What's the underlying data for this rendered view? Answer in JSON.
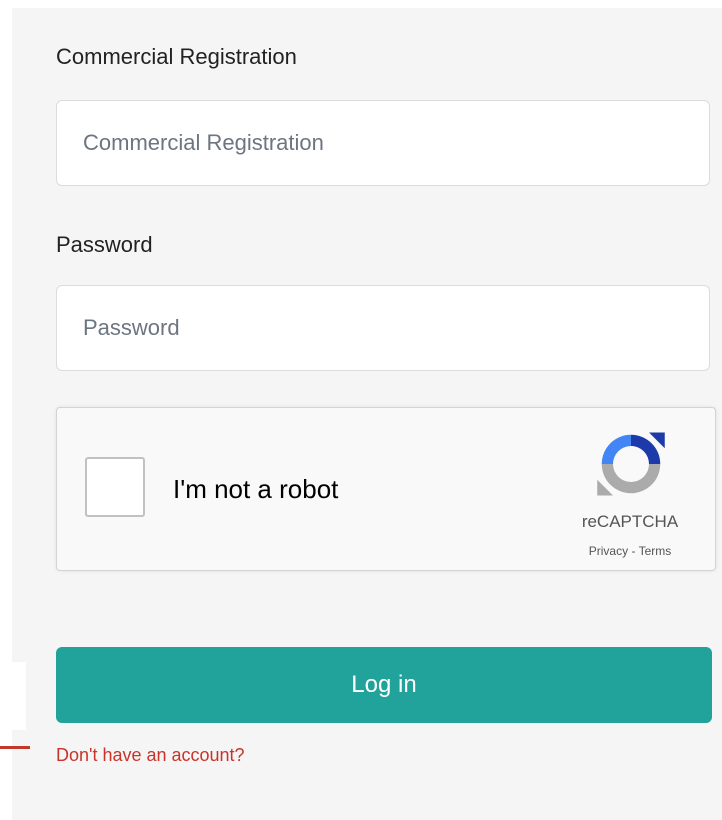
{
  "form": {
    "commercial_registration": {
      "label": "Commercial Registration",
      "placeholder": "Commercial Registration",
      "value": ""
    },
    "password": {
      "label": "Password",
      "placeholder": "Password",
      "value": ""
    },
    "recaptcha": {
      "checkbox_label": "I'm not a robot",
      "brand": "reCAPTCHA",
      "privacy_label": "Privacy",
      "separator": " - ",
      "terms_label": "Terms",
      "checked": false
    },
    "login_label": "Log in",
    "signup_link": "Don't have an account?"
  },
  "colors": {
    "accent": "#21a29a",
    "link": "#c9342a",
    "panel_background": "#f5f5f5",
    "recaptcha_blue": "#1c3aa9",
    "recaptcha_light_blue": "#4285f4",
    "recaptcha_gray": "#ababab"
  }
}
